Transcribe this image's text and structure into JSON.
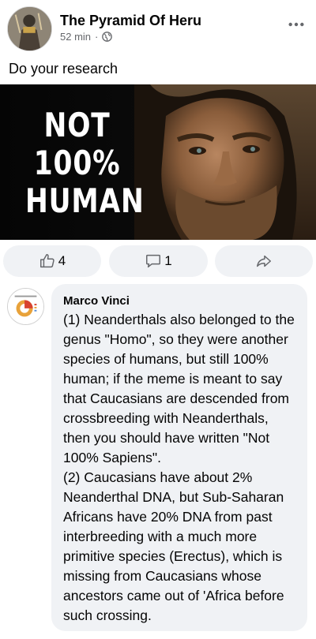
{
  "post": {
    "author": "The Pyramid Of Heru",
    "time": "52 min",
    "separator": "·",
    "audience_icon": "globe-icon",
    "more_icon": "more-options-icon",
    "text": "Do your research",
    "image": {
      "caption_line1": "NOT",
      "caption_line2": "100%",
      "caption_line3": "HUMAN"
    }
  },
  "actions": {
    "like_icon": "thumbs-up-icon",
    "like_count": "4",
    "comment_icon": "comment-icon",
    "comment_count": "1",
    "share_icon": "share-icon"
  },
  "comment": {
    "author": "Marco Vinci",
    "text": "(1) Neanderthals also belonged to the genus \"Homo\", so they were another species of humans, but still 100% human;  if the meme is meant to say that Caucasians are descended from crossbreeding with Neanderthals, then you should have written \"Not 100% Sapiens\".\n(2) Caucasians have about 2% Neanderthal DNA, but Sub-Saharan Africans have 20% DNA from past interbreeding with a much more primitive species (Erectus), which is missing from Caucasians whose ancestors came out of 'Africa before such crossing."
  },
  "colors": {
    "background": "#ffffff",
    "secondary_text": "#65676b",
    "button_bg": "#f0f2f5",
    "bubble_bg": "#f0f2f5"
  }
}
